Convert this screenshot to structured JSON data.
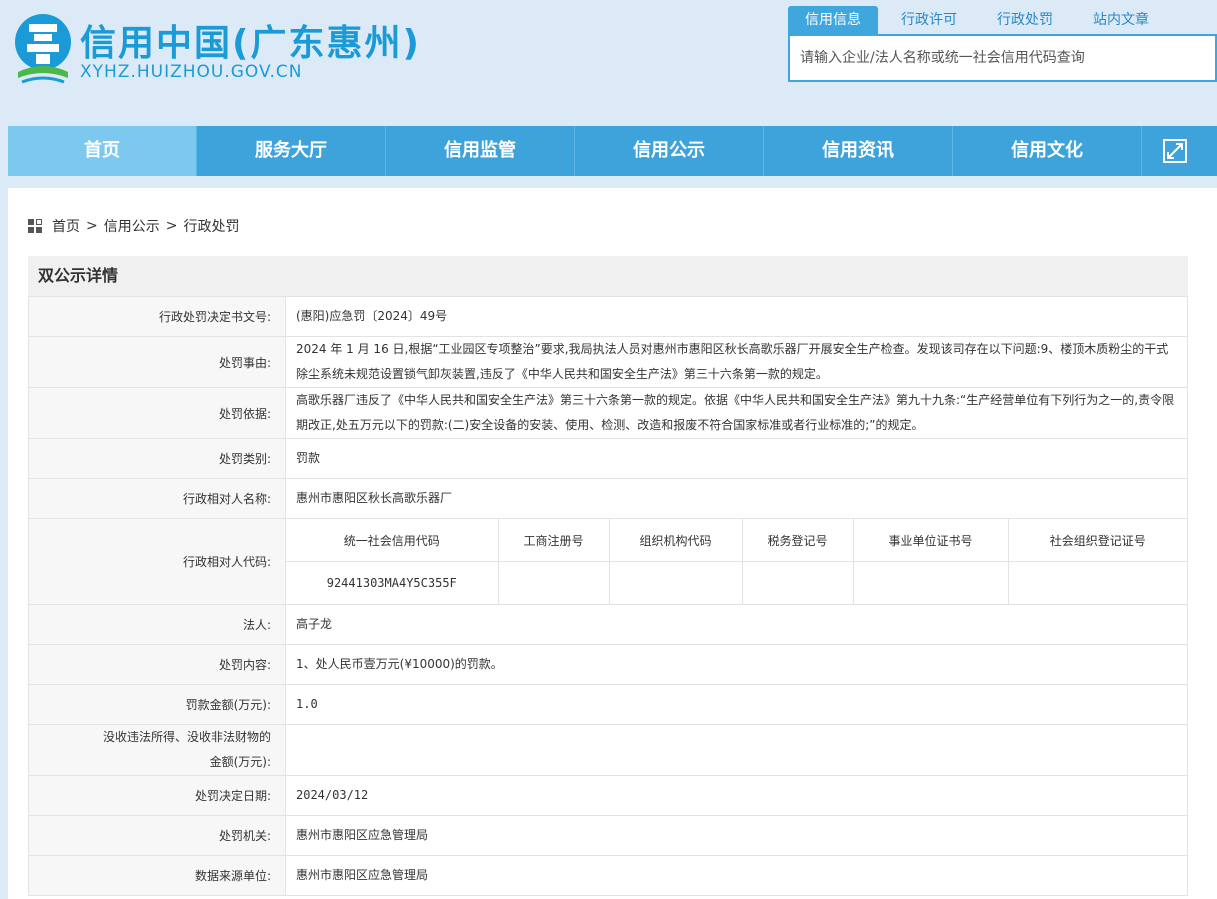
{
  "header": {
    "title": "信用中国(广东惠州)",
    "url": "XYHZ.HUIZHOU.GOV.CN"
  },
  "search": {
    "tabs": [
      {
        "label": "信用信息"
      },
      {
        "label": "行政许可"
      },
      {
        "label": "行政处罚"
      },
      {
        "label": "站内文章"
      }
    ],
    "placeholder": "请输入企业/法人名称或统一社会信用代码查询"
  },
  "nav": {
    "items": [
      {
        "label": "首页"
      },
      {
        "label": "服务大厅"
      },
      {
        "label": "信用监管"
      },
      {
        "label": "信用公示"
      },
      {
        "label": "信用资讯"
      },
      {
        "label": "信用文化"
      }
    ],
    "expand_icon": "expand-icon"
  },
  "breadcrumb": {
    "home": "首页",
    "sep": ">",
    "level1": "信用公示",
    "level2": "行政处罚"
  },
  "detail": {
    "title": "双公示详情",
    "doc_no_label": "行政处罚决定书文号:",
    "doc_no": "(惠阳)应急罚〔2024〕49号",
    "reason_label": "处罚事由:",
    "reason": "2024 年 1 月 16 日,根据“工业园区专项整治”要求,我局执法人员对惠州市惠阳区秋长高歌乐器厂开展安全生产检查。发现该司存在以下问题:9、楼顶木质粉尘的干式除尘系统未规范设置锁气卸灰装置,违反了《中华人民共和国安全生产法》第三十六条第一款的规定。",
    "basis_label": "处罚依据:",
    "basis": "高歌乐器厂违反了《中华人民共和国安全生产法》第三十六条第一款的规定。依据《中华人民共和国安全生产法》第九十九条:“生产经营单位有下列行为之一的,责令限期改正,处五万元以下的罚款:(二)安全设备的安装、使用、检测、改造和报废不符合国家标准或者行业标准的;”的规定。",
    "category_label": "处罚类别:",
    "category": "罚款",
    "party_name_label": "行政相对人名称:",
    "party_name": "惠州市惠阳区秋长高歌乐器厂",
    "party_code_label": "行政相对人代码:",
    "code_headers": [
      "统一社会信用代码",
      "工商注册号",
      "组织机构代码",
      "税务登记号",
      "事业单位证书号",
      "社会组织登记证号"
    ],
    "code_values": [
      "92441303MA4Y5C355F",
      "",
      "",
      "",
      "",
      ""
    ],
    "legal_person_label": "法人:",
    "legal_person": "高子龙",
    "content_label": "处罚内容:",
    "content": "1、处人民币壹万元(¥10000)的罚款。",
    "amount_label": "罚款金额(万元):",
    "amount": "1.0",
    "confiscate_label_1": "没收违法所得、没收非法财物的",
    "confiscate_label_2": "金额(万元):",
    "confiscate": "",
    "date_label": "处罚决定日期:",
    "date": "2024/03/12",
    "authority_label": "处罚机关:",
    "authority": "惠州市惠阳区应急管理局",
    "source_label": "数据来源单位:",
    "source": "惠州市惠阳区应急管理局"
  },
  "colors": {
    "brand": "#1a9bd7",
    "nav_bg": "#3da3da",
    "nav_active": "#7cc8ee",
    "page_bg": "#dbeaf6"
  }
}
